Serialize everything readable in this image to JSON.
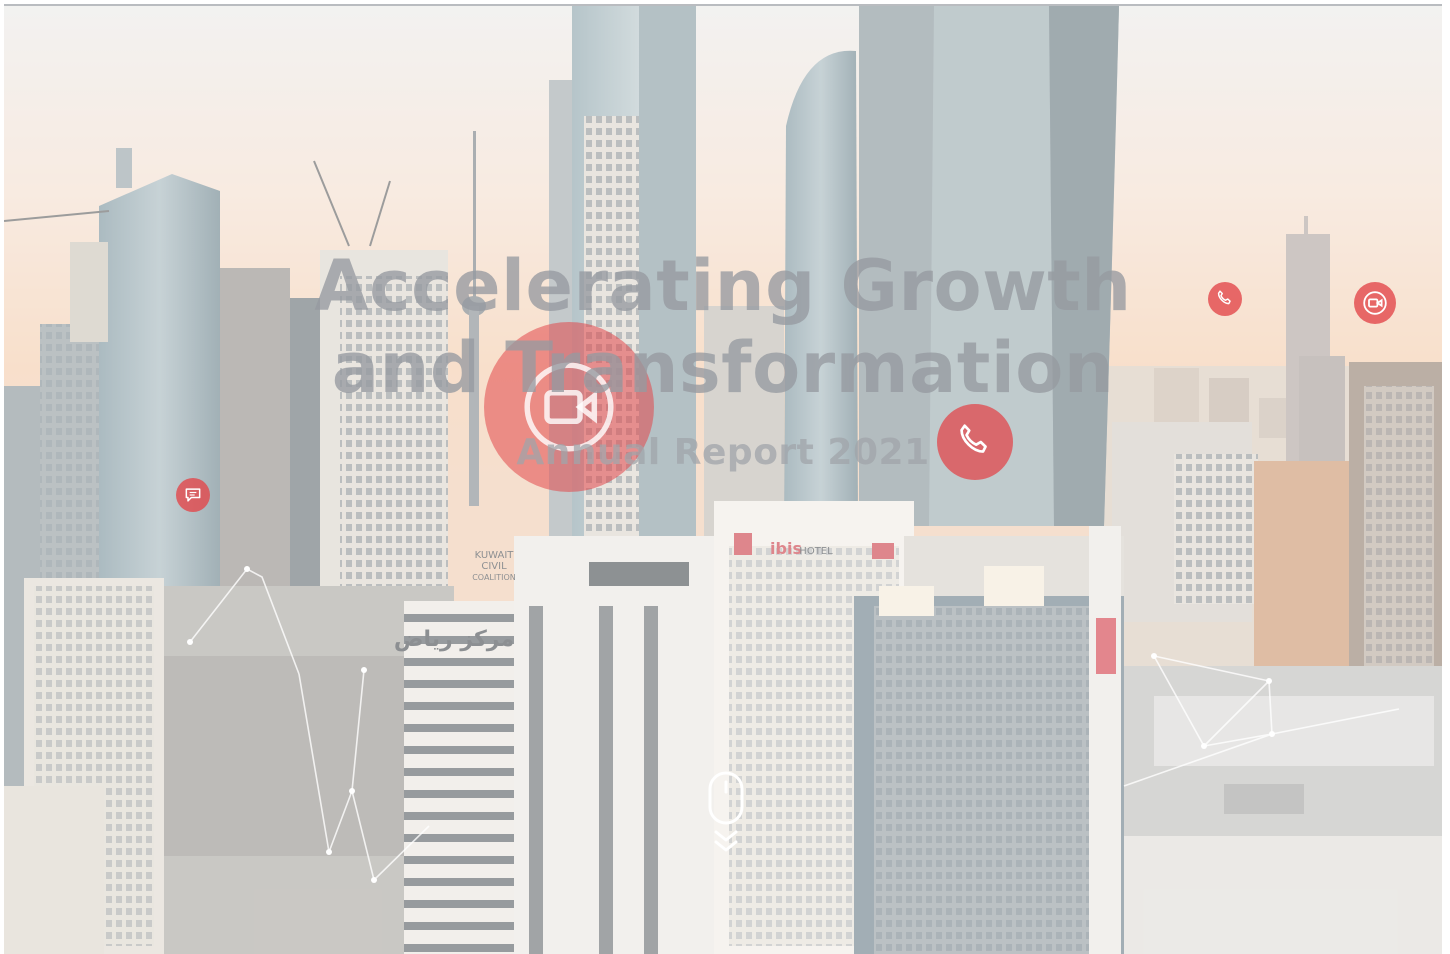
{
  "hero": {
    "title_line1": "Accelerating Growth",
    "title_line2": "and Transformation",
    "subtitle": "Annual Report 2021"
  },
  "signs": {
    "left_building": "مركز رياض",
    "kuwait_civil_1": "KUWAIT",
    "kuwait_civil_2": "CIVIL",
    "kuwait_civil_3": "COALITION",
    "ibis": "ibis",
    "ibis_hotel": "HOTEL"
  },
  "icons": {
    "video_call": "video-call-icon",
    "phone": "phone-icon",
    "chat": "chat-icon",
    "mouse": "mouse-scroll-icon",
    "chevrons": "chevron-down-icon"
  },
  "colors": {
    "accent_red": "#e2474b",
    "title_gray": "#969aa0"
  }
}
